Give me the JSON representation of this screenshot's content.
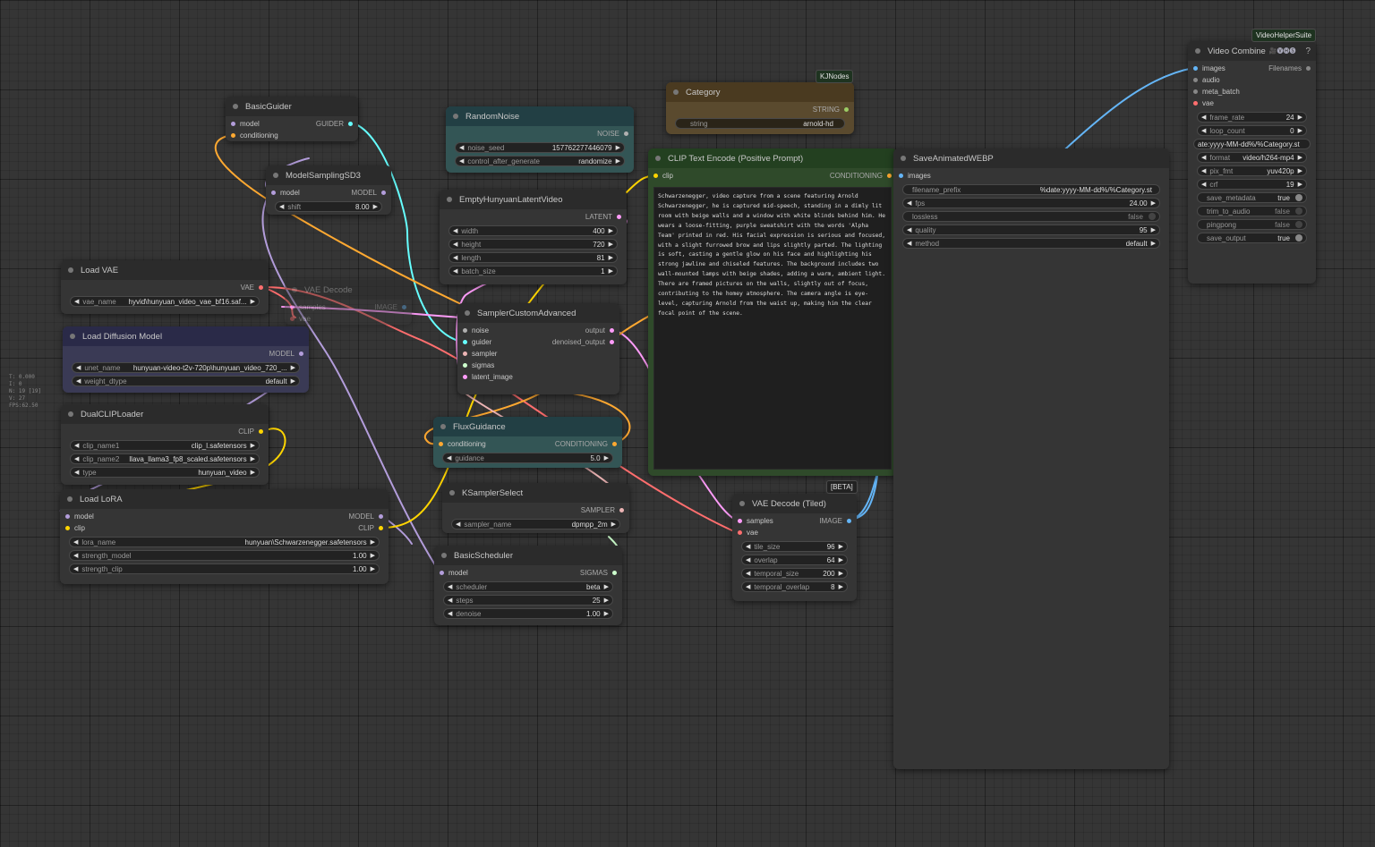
{
  "app": {
    "name": "ComfyUI workflow canvas"
  },
  "stats": [
    "T: 0.000",
    "I: 0",
    "N: 19 [19]",
    "V: 27",
    "FPS:62.50"
  ],
  "badges": {
    "kjnodes": "KJNodes",
    "vhs": "VideoHelperSuite",
    "beta": "[BETA]"
  },
  "colors": {
    "model": "#b39ddb",
    "clip": "#ffd500",
    "vae": "#ff6e6e",
    "conditioning": "#ffa931",
    "latent": "#ff9cf9",
    "image": "#64b5f6",
    "noise": "#b0b0b0",
    "guider": "#66ffff",
    "sampler": "#ecb4b4",
    "sigmas": "#cdffcd"
  },
  "nodes": {
    "basic_guider": {
      "title": "BasicGuider",
      "inputs": [
        "model",
        "conditioning"
      ],
      "output": "GUIDER"
    },
    "model_sampling": {
      "title": "ModelSamplingSD3",
      "input": "model",
      "output": "MODEL",
      "shift_label": "shift",
      "shift": "8.00"
    },
    "load_vae": {
      "title": "Load VAE",
      "output": "VAE",
      "vae_name_label": "vae_name",
      "vae_name": "hyvid\\hunyuan_video_vae_bf16.saf..."
    },
    "vae_decode": {
      "title": "VAE Decode",
      "inputs": [
        "samples",
        "vae"
      ],
      "output": "IMAGE"
    },
    "load_diffusion": {
      "title": "Load Diffusion Model",
      "output": "MODEL",
      "unet_label": "unet_name",
      "unet": "hunyuan-video-t2v-720p\\hunyuan_video_720_...",
      "dtype_label": "weight_dtype",
      "dtype": "default"
    },
    "dual_clip": {
      "title": "DualCLIPLoader",
      "output": "CLIP",
      "clip1_label": "clip_name1",
      "clip1": "clip_l.safetensors",
      "clip2_label": "clip_name2",
      "clip2": "llava_llama3_fp8_scaled.safetensors",
      "type_label": "type",
      "type": "hunyuan_video"
    },
    "load_lora": {
      "title": "Load LoRA",
      "inputs": [
        "model",
        "clip"
      ],
      "outputs": [
        "MODEL",
        "CLIP"
      ],
      "lora_label": "lora_name",
      "lora": "hunyuan\\Schwarzenegger.safetensors",
      "sm_label": "strength_model",
      "sm": "1.00",
      "sc_label": "strength_clip",
      "sc": "1.00"
    },
    "random_noise": {
      "title": "RandomNoise",
      "output": "NOISE",
      "seed_label": "noise_seed",
      "seed": "157762277446079",
      "cag_label": "control_after_generate",
      "cag": "randomize"
    },
    "empty_latent": {
      "title": "EmptyHunyuanLatentVideo",
      "output": "LATENT",
      "w_label": "width",
      "w": "400",
      "h_label": "height",
      "h": "720",
      "len_label": "length",
      "len": "81",
      "bs_label": "batch_size",
      "bs": "1"
    },
    "sampler_adv": {
      "title": "SamplerCustomAdvanced",
      "inputs": [
        "noise",
        "guider",
        "sampler",
        "sigmas",
        "latent_image"
      ],
      "outputs": [
        "output",
        "denoised_output"
      ]
    },
    "flux_guidance": {
      "title": "FluxGuidance",
      "input": "conditioning",
      "output": "CONDITIONING",
      "g_label": "guidance",
      "g": "5.0"
    },
    "ksampler_select": {
      "title": "KSamplerSelect",
      "output": "SAMPLER",
      "sn_label": "sampler_name",
      "sn": "dpmpp_2m"
    },
    "basic_scheduler": {
      "title": "BasicScheduler",
      "input": "model",
      "output": "SIGMAS",
      "sch_label": "scheduler",
      "sch": "beta",
      "steps_label": "steps",
      "steps": "25",
      "den_label": "denoise",
      "den": "1.00"
    },
    "category": {
      "title": "Category",
      "output": "STRING",
      "s_label": "string",
      "s": "arnold-hd"
    },
    "clip_text": {
      "title": "CLIP Text Encode (Positive Prompt)",
      "input": "clip",
      "output": "CONDITIONING",
      "text": "Schwarzenegger, video capture from a scene featuring Arnold Schwarzenegger, he is captured mid-speech, standing in a dimly lit room with beige walls and a window with white blinds behind him. He wears a loose-fitting, purple sweatshirt with the words 'Alpha Team' printed in red. His facial expression is serious and focused, with a slight furrowed brow and lips slightly parted. The lighting is soft, casting a gentle glow on his face and highlighting his strong jawline and chiseled features. The background includes two wall-mounted lamps with beige shades, adding a warm, ambient light. There are framed pictures on the walls, slightly out of focus, contributing to the homey atmosphere. The camera angle is eye-level, capturing Arnold from the waist up, making him the clear focal point of the scene."
    },
    "save_webp": {
      "title": "SaveAnimatedWEBP",
      "input": "images",
      "fp_label": "filename_prefix",
      "fp": "%date:yyyy-MM-dd%/%Category.st",
      "fps_label": "fps",
      "fps": "24.00",
      "lossless_label": "lossless",
      "lossless": "false",
      "q_label": "quality",
      "q": "95",
      "m_label": "method",
      "m": "default"
    },
    "vae_decode_tiled": {
      "title": "VAE Decode (Tiled)",
      "inputs": [
        "samples",
        "vae"
      ],
      "output": "IMAGE",
      "ts_label": "tile_size",
      "ts": "96",
      "ov_label": "overlap",
      "ov": "64",
      "tsz_label": "temporal_size",
      "tsz": "200",
      "to_label": "temporal_overlap",
      "to": "8"
    },
    "video_combine": {
      "title": "Video Combine",
      "title_icons": "🎥🅥🅗🅢",
      "help": "?",
      "inputs": [
        "images",
        "audio",
        "meta_batch",
        "vae"
      ],
      "output": "Filenames",
      "fr_label": "frame_rate",
      "fr": "24",
      "lc_label": "loop_count",
      "lc": "0",
      "prefix": "ate:yyyy-MM-dd%/%Category.st",
      "fmt_label": "format",
      "fmt": "video/h264-mp4",
      "pf_label": "pix_fmt",
      "pf": "yuv420p",
      "crf_label": "crf",
      "crf": "19",
      "sm_label": "save_metadata",
      "sm": "true",
      "ta_label": "trim_to_audio",
      "ta": "false",
      "pp_label": "pingpong",
      "pp": "false",
      "so_label": "save_output",
      "so": "true"
    }
  }
}
